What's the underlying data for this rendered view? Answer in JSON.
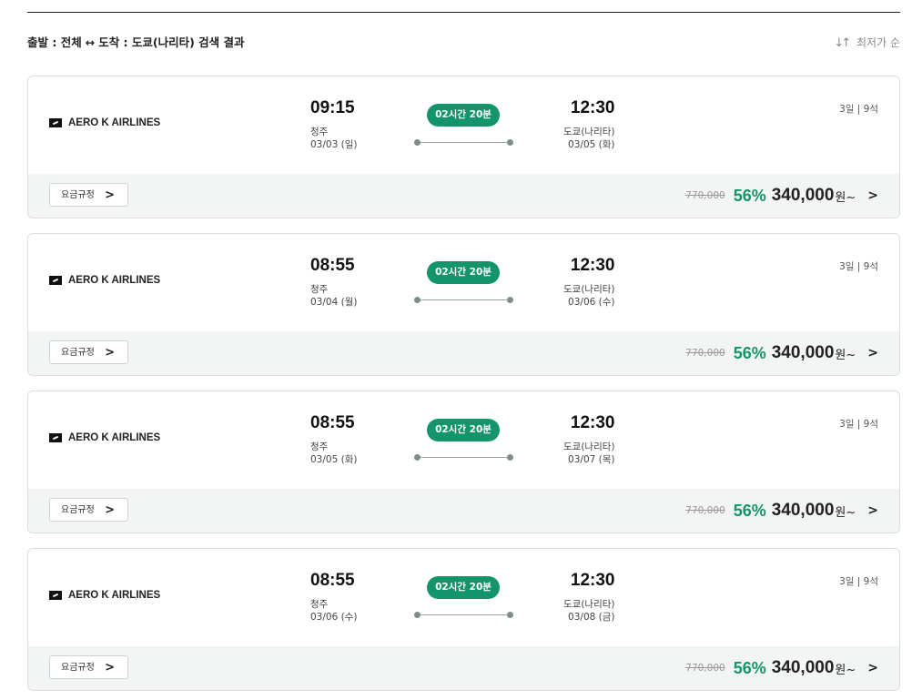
{
  "header": {
    "search_summary_prefix": "출발 : 전체",
    "search_summary_arrow": "↔",
    "search_summary_suffix": "도착 : 도쿄(나리타) 검색 결과",
    "sort_label": "최저가 순",
    "sort_icon": "sort-arrows-icon"
  },
  "fare_rule_label": "요금규정",
  "flights": [
    {
      "airline": "AERO K AIRLINES",
      "dep_time": "09:15",
      "dep_place": "청주",
      "dep_date": "03/03 (일)",
      "duration": "02시간 20분",
      "arr_time": "12:30",
      "arr_place": "도쿄(나리타)",
      "arr_date": "03/05 (화)",
      "seats": "3일 | 9석",
      "orig_price": "770,000",
      "discount": "56%",
      "price": "340,000",
      "currency": "원~"
    },
    {
      "airline": "AERO K AIRLINES",
      "dep_time": "08:55",
      "dep_place": "청주",
      "dep_date": "03/04 (월)",
      "duration": "02시간 20분",
      "arr_time": "12:30",
      "arr_place": "도쿄(나리타)",
      "arr_date": "03/06 (수)",
      "seats": "3일 | 9석",
      "orig_price": "770,000",
      "discount": "56%",
      "price": "340,000",
      "currency": "원~"
    },
    {
      "airline": "AERO K AIRLINES",
      "dep_time": "08:55",
      "dep_place": "청주",
      "dep_date": "03/05 (화)",
      "duration": "02시간 20분",
      "arr_time": "12:30",
      "arr_place": "도쿄(나리타)",
      "arr_date": "03/07 (목)",
      "seats": "3일 | 9석",
      "orig_price": "770,000",
      "discount": "56%",
      "price": "340,000",
      "currency": "원~"
    },
    {
      "airline": "AERO K AIRLINES",
      "dep_time": "08:55",
      "dep_place": "청주",
      "dep_date": "03/06 (수)",
      "duration": "02시간 20분",
      "arr_time": "12:30",
      "arr_place": "도쿄(나리타)",
      "arr_date": "03/08 (금)",
      "seats": "3일 | 9석",
      "orig_price": "770,000",
      "discount": "56%",
      "price": "340,000",
      "currency": "원~"
    }
  ],
  "colors": {
    "accent_green": "#14946b",
    "strike_gray": "#999999",
    "bottom_bar_bg": "#f3f5f4"
  }
}
